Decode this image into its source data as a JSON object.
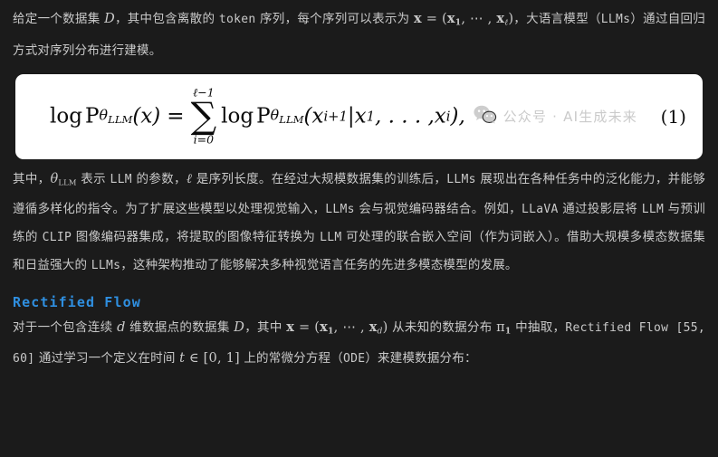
{
  "colors": {
    "background": "#1b1b1b",
    "body_text": "#c9c9c9",
    "heading_accent": "#2f8fe0",
    "card_background": "#ffffff",
    "card_text": "#0b0b0b",
    "watermark_text": "#c6c6c6"
  },
  "intro_paragraph": {
    "seg1": "给定一个数据集 ",
    "math_D": "D",
    "seg2": "，其中包含离散的 ",
    "mono_token": "token",
    "seg3": " 序列，每个序列可以表示为 ",
    "math_x": "x",
    "math_eq": " = (",
    "math_x1": "x",
    "math_x1_sub": "1",
    "math_dots": ", ⋯ , ",
    "math_xl": "x",
    "math_xl_sub": "ℓ",
    "math_close": ")",
    "seg4": "，大语言模型（",
    "mono_llms": "LLMs",
    "seg5": "）通过自回归方式对序列分布进行建模。"
  },
  "equation": {
    "log": "log",
    "P": "P",
    "theta": "θ",
    "theta_sub": "LLM",
    "arg_x": "(x)",
    "equals": "=",
    "sum_upper": "ℓ−1",
    "sum_symbol": "∑",
    "sum_lower": "i=0",
    "log2": "log",
    "P2": "P",
    "theta2": "θ",
    "theta2_sub": "LLM",
    "arg_open": "(",
    "arg_x1": "x",
    "arg_x1_sub": "i+1",
    "arg_bar": "|",
    "arg_x2": "x",
    "arg_x2_sub": "1",
    "arg_dots": ", . . . ,",
    "arg_x3": "x",
    "arg_x3_sub": "i",
    "arg_close": "),",
    "number": "(1)"
  },
  "watermark": {
    "icon": "wechat-icon",
    "text": "公众号 · AI生成未来"
  },
  "body_paragraph": {
    "seg1": "其中，",
    "math_theta": "θ",
    "math_theta_sub": "LLM",
    "seg2": " 表示 ",
    "mono_llm": "LLM",
    "seg3": " 的参数，",
    "math_ell": "ℓ",
    "seg4": " 是序列长度。在经过大规模数据集的训练后，",
    "mono_llms": "LLMs",
    "seg5": " 展现出在各种任务中的泛化能力，并能够遵循多样化的指令。为了扩展这些模型以处理视觉输入，",
    "mono_llms2": "LLMs",
    "seg6": " 会与视觉编码器结合。例如，",
    "mono_llava": "LLaVA",
    "seg7": " 通过投影层将 ",
    "mono_llm2": "LLM",
    "seg8": " 与预训练的 ",
    "mono_clip": "CLIP",
    "seg9": " 图像编码器集成，将提取的图像特征转换为 ",
    "mono_llm3": "LLM",
    "seg10": " 可处理的联合嵌入空间（作为词嵌入）。借助大规模多模态数据集和日益强大的 ",
    "mono_llms3": "LLMs",
    "seg11": "，这种架构推动了能够解决多种视觉语言任务的先进多模态模型的发展。"
  },
  "section_heading": "Rectified Flow",
  "rf_paragraph": {
    "seg1": "对于一个包含连续 ",
    "math_d": "d",
    "seg2": " 维数据点的数据集 ",
    "math_D": "D",
    "seg3": "，其中 ",
    "math_x": "x",
    "math_eq": " = (",
    "math_x1": "x",
    "math_x1_sub": "1",
    "math_dots": ", ⋯ , ",
    "math_xd": "x",
    "math_xd_sub": "d",
    "math_close": ")",
    "seg4": " 从未知的数据分布 ",
    "math_pi": "π",
    "math_pi_sub": "1",
    "seg5": " 中抽取，",
    "mono_rf": "Rectified Flow",
    "mono_refs": " [55, 60]",
    "seg6": " 通过学习一个定义在时间 ",
    "math_t": "t",
    "math_in": " ∈ ",
    "math_interval": "[0, 1]",
    "seg7": " 上的常微分方程（",
    "mono_ode": "ODE",
    "seg8": "）来建模数据分布："
  }
}
